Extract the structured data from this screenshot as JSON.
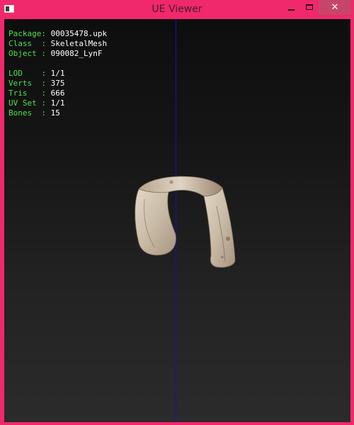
{
  "window": {
    "title": "UE Viewer",
    "close_glyph": "✕",
    "colors": {
      "frame": "#f0286c",
      "close_button": "#c8456a",
      "label": "#4ee04e",
      "value": "#ffffff",
      "axis": "#1010c8"
    }
  },
  "info": {
    "package": {
      "label": "Package:",
      "value": "00035478.upk"
    },
    "class": {
      "label": "Class  :",
      "value": "SkeletalMesh"
    },
    "object": {
      "label": "Object :",
      "value": "090082_LynF"
    },
    "lod": {
      "label": "LOD    :",
      "value": "1/1"
    },
    "verts": {
      "label": "Verts  :",
      "value": "375"
    },
    "tris": {
      "label": "Tris   :",
      "value": "666"
    },
    "uvset": {
      "label": "UV Set :",
      "value": "1/1"
    },
    "bones": {
      "label": "Bones  :",
      "value": "15"
    }
  },
  "icons": {
    "app": "window-icon",
    "minimize": "minimize-icon",
    "maximize": "maximize-icon",
    "close": "close-icon",
    "mesh": "scarf-mesh"
  }
}
